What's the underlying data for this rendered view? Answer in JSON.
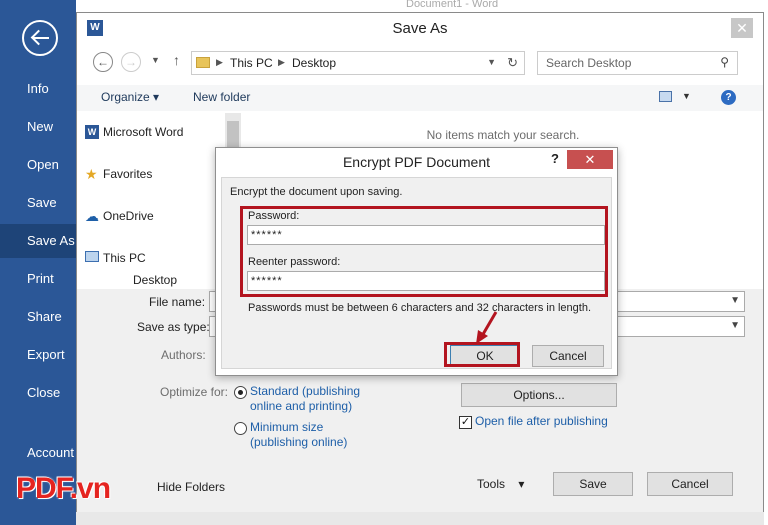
{
  "backstage": {
    "items": [
      {
        "label": "Info"
      },
      {
        "label": "New"
      },
      {
        "label": "Open"
      },
      {
        "label": "Save"
      },
      {
        "label": "Save As"
      },
      {
        "label": "Print"
      },
      {
        "label": "Share"
      },
      {
        "label": "Export"
      },
      {
        "label": "Close"
      },
      {
        "label": "Account"
      }
    ],
    "active": "Save As",
    "back_icon": "back-arrow-icon"
  },
  "behind_title": "Document1 - Word",
  "saveas": {
    "title": "Save As",
    "app_icon_letter": "W",
    "close_glyph": "✕",
    "address": {
      "crumbs": [
        "This PC",
        "Desktop"
      ]
    },
    "search_placeholder": "Search Desktop",
    "toolbar": {
      "organize": "Organize ▾",
      "new_folder": "New folder"
    },
    "nav_items": [
      {
        "label": "Microsoft Word"
      },
      {
        "label": "Favorites"
      },
      {
        "label": "OneDrive"
      },
      {
        "label": "This PC"
      },
      {
        "label": "Desktop"
      }
    ],
    "empty_message": "No items match your search.",
    "file_name_label": "File name:",
    "save_as_type_label": "Save as type:",
    "authors_label": "Authors:",
    "optimize_label": "Optimize for:",
    "radio_standard": "Standard (publishing online and printing)",
    "radio_minimum": "Minimum size (publishing online)",
    "options_button": "Options...",
    "open_after_label": "Open file after publishing",
    "open_after_checked": true,
    "hide_folders": "Hide Folders",
    "tools_label": "Tools",
    "save_button": "Save",
    "cancel_button": "Cancel"
  },
  "encrypt": {
    "title": "Encrypt PDF Document",
    "help": "?",
    "close_glyph": "✕",
    "intro": "Encrypt the document upon saving.",
    "password_label": "Password:",
    "password_value": "******",
    "reenter_label": "Reenter password:",
    "reenter_value": "******",
    "hint": "Passwords must be between 6 characters and 32 characters in length.",
    "ok": "OK",
    "cancel": "Cancel"
  },
  "watermark": "PDF.vn",
  "colors": {
    "backstage": "#2b5797",
    "highlight": "#b3141f",
    "link": "#1e5fa8"
  }
}
